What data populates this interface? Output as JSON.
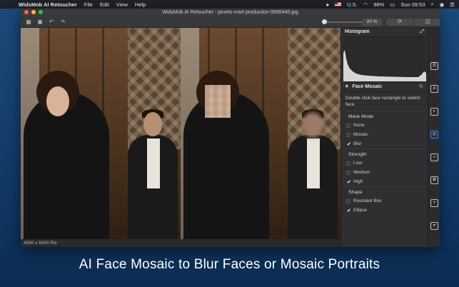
{
  "menubar": {
    "app_name": "WidsMob AI Retoucher",
    "menus": [
      "File",
      "Edit",
      "View",
      "Help"
    ],
    "input_source": "U.S.",
    "battery": "98%",
    "clock": "Sun 09:53"
  },
  "window": {
    "title": "WidsMob AI Retoucher - pexels-mart-production-9566440.jpg",
    "zoom_value": "20 %",
    "zoom_fraction": 0.0
  },
  "statusbar": {
    "dimensions": "4000 x 6000 Pix"
  },
  "panel": {
    "histogram_title": "Histogram",
    "section_title": "Face Mosaic",
    "hint": "Double click face rectangle to switch face.",
    "groups": [
      {
        "title": "Mask Mode",
        "options": [
          {
            "label": "None",
            "checked": false
          },
          {
            "label": "Mosaic",
            "checked": false
          },
          {
            "label": "Blur",
            "checked": true
          }
        ]
      },
      {
        "title": "Strength",
        "options": [
          {
            "label": "Low",
            "checked": false
          },
          {
            "label": "Medium",
            "checked": false
          },
          {
            "label": "High",
            "checked": true
          }
        ]
      },
      {
        "title": "Shape",
        "options": [
          {
            "label": "Rounded Box",
            "checked": false
          },
          {
            "label": "Ellipse",
            "checked": true
          }
        ]
      }
    ]
  },
  "tools": [
    "adjust-icon",
    "ai-icon",
    "portrait-icon",
    "mosaic-icon",
    "search-icon",
    "settings-icon",
    "retouch-icon",
    "crop-icon"
  ],
  "caption": "AI Face Mosaic to Blur Faces or Mosaic Portraits",
  "colors": {
    "accent": "#3d8de0",
    "close": "#ff5f57",
    "minimize": "#febc2e",
    "maximize": "#28c840"
  }
}
